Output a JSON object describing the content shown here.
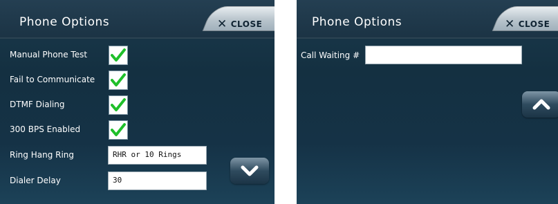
{
  "left_screen": {
    "title": "Phone Options",
    "close_label": "CLOSE",
    "rows": [
      {
        "label": "Manual Phone Test",
        "checked": true
      },
      {
        "label": "Fail to Communicate",
        "checked": true
      },
      {
        "label": "DTMF Dialing",
        "checked": true
      },
      {
        "label": "300 BPS Enabled",
        "checked": true
      },
      {
        "label": "Ring Hang Ring",
        "value": "RHR or 10 Rings"
      },
      {
        "label": "Dialer Delay",
        "value": "30"
      }
    ],
    "scroll_button_icon": "chevron-down-icon"
  },
  "right_screen": {
    "title": "Phone Options",
    "close_label": "CLOSE",
    "call_waiting_label": "Call Waiting #",
    "call_waiting_value": "",
    "scroll_button_icon": "chevron-up-icon"
  },
  "colors": {
    "panel_bg": "#153246",
    "check_green": "#1fbf2a",
    "close_text": "#0f2332"
  }
}
